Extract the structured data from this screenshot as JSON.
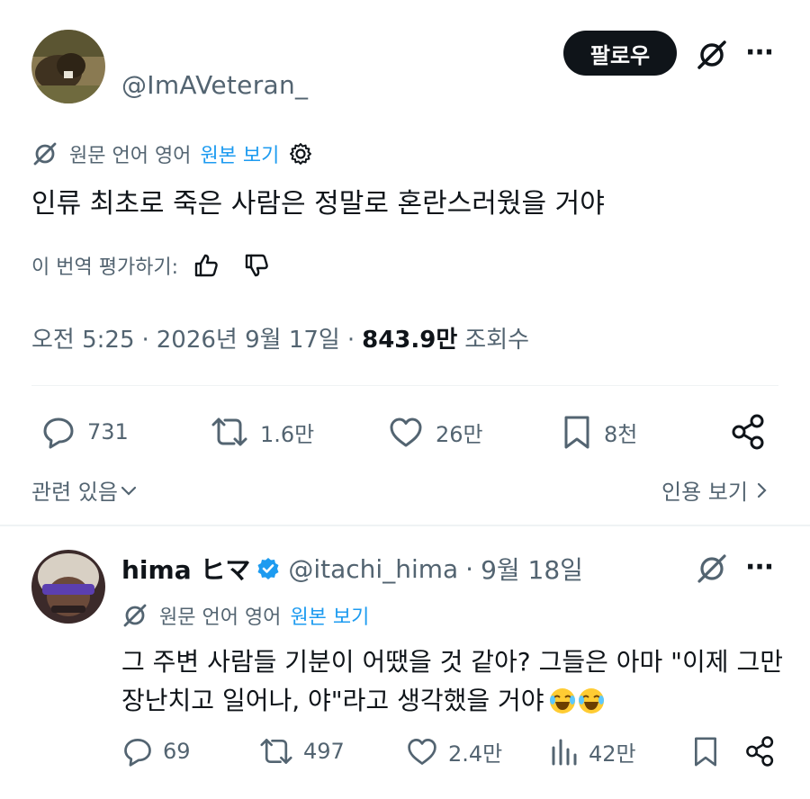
{
  "main_tweet": {
    "handle": "@ImAVeteran_",
    "follow_label": "팔로우",
    "translation": {
      "source_label": "원문 언어 영어",
      "view_original": "원본 보기"
    },
    "text": "인류 최초로 죽은 사람은 정말로 혼란스러웠을 거야",
    "rate_label": "이 번역 평가하기:",
    "time": "오전 5:25",
    "date": "2026년 9월 17일",
    "views_count": "843.9만",
    "views_label": "조회수",
    "separator": "·",
    "actions": {
      "replies": "731",
      "retweets": "1.6만",
      "likes": "26만",
      "bookmarks": "8천"
    },
    "related_label": "관련 있음",
    "quotes_label": "인용 보기"
  },
  "reply": {
    "name": "hima ヒマ",
    "handle": "@itachi_hima",
    "date": "9월 18일",
    "separator": "·",
    "translation": {
      "source_label": "원문 언어 영어",
      "view_original": "원본 보기"
    },
    "text_line1": "그 주변 사람들 기분이 어땠을 것 같아? 그들은 아마 \"이제 그만",
    "text_line2": "장난치고 일어나, 야\"라고 생각했을 거야",
    "actions": {
      "replies": "69",
      "retweets": "497",
      "likes": "2.4만",
      "views": "42만"
    }
  },
  "colors": {
    "text": "#0f1419",
    "secondary": "#536471",
    "link": "#1d9bf0",
    "verified": "#1d9bf0",
    "follow_bg": "#0f1419"
  },
  "icons": [
    "grok-icon",
    "more-icon",
    "translate-icon",
    "gear-icon",
    "thumbs-up-icon",
    "thumbs-down-icon",
    "reply-icon",
    "retweet-icon",
    "like-icon",
    "bookmark-icon",
    "share-icon",
    "views-icon",
    "verified-badge-icon",
    "chevron-down-icon",
    "chevron-right-icon",
    "laughing-emoji"
  ]
}
